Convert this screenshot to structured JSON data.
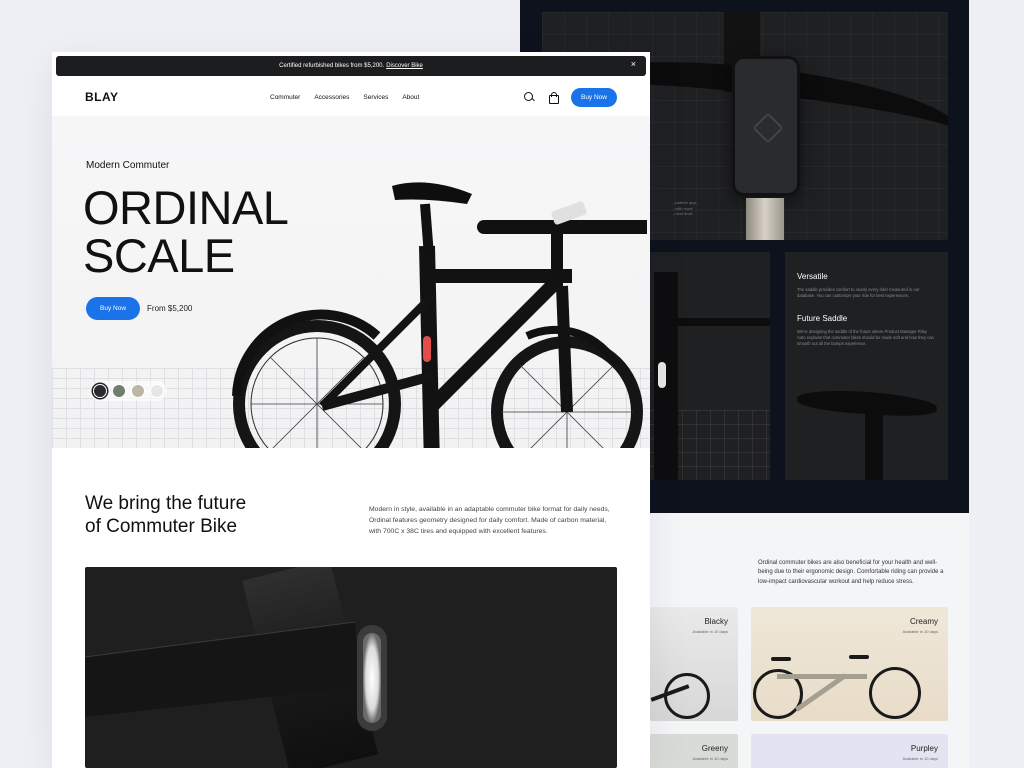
{
  "announcement": {
    "text": "Certified refurbished bikes from $5,200.",
    "link": "Discover Bike",
    "close": "×"
  },
  "nav": {
    "logo": "BLAY",
    "links": [
      "Commuter",
      "Accessories",
      "Services",
      "About"
    ],
    "cta": "Buy Now",
    "icons": [
      "search-icon",
      "bag-icon"
    ]
  },
  "hero": {
    "kicker": "Modern Commuter",
    "title": "ORDINAL\nSCALE",
    "cta": "Buy Now",
    "price": "From $5,200",
    "swatches": [
      {
        "color": "#2a2b2e",
        "selected": true
      },
      {
        "color": "#6f7f6c",
        "selected": false
      },
      {
        "color": "#bdb6a6",
        "selected": false
      },
      {
        "color": "#e6e6e8",
        "selected": false
      }
    ]
  },
  "mission": {
    "title": "We bring the future\nof Commuter Bike",
    "text": "Modern in style, available in an adaptable commuter bike format for daily needs, Ordinal features geometry designed for daily comfort. Made of carbon material, with 700C x 38C tires and equipped with excellent features."
  },
  "detail_panel": {
    "side_text": "...partner app...\n...with more\n...next level.",
    "cards": [
      {
        "title": "Versatile",
        "text": "The saddle provides comfort to nearly every rider measured in our database. You can customize your ride for best experiences."
      },
      {
        "title": "Future Saddle",
        "text": "We're designing the saddle of the future where Product Manager Riley Auto explains that commuter bikes should be made soft and how they can smooth out all the bumps experience."
      }
    ]
  },
  "colors_section": {
    "text": "Ordinal commuter bikes are also beneficial for your health and well-being due to their ergonomic design. Comfortable riding can provide a low-impact cardiovascular workout and help reduce stress.",
    "variants": [
      {
        "name": "Blacky",
        "availability": "Available in 10 days"
      },
      {
        "name": "Creamy",
        "availability": "Available in 10 days"
      },
      {
        "name": "Greeny",
        "availability": "Available in 10 days"
      },
      {
        "name": "Purpley",
        "availability": "Available in 10 days"
      }
    ]
  },
  "colors": {
    "accent": "#1a73e8",
    "dark": "#0d121c",
    "announcement_bg": "#1c1d1f"
  }
}
